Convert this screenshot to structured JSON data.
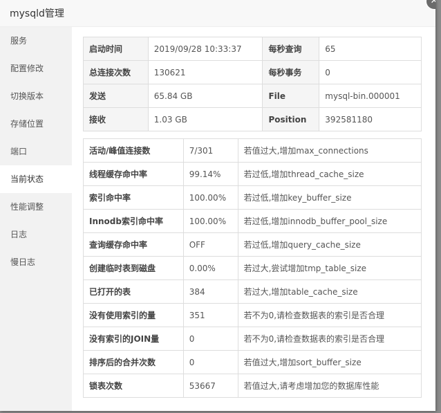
{
  "dialog": {
    "title": "mysqld管理",
    "close_icon": "close-icon"
  },
  "sidebar": {
    "active_index": 5,
    "items": [
      {
        "label": "服务"
      },
      {
        "label": "配置修改"
      },
      {
        "label": "切换版本"
      },
      {
        "label": "存储位置"
      },
      {
        "label": "端口"
      },
      {
        "label": "当前状态"
      },
      {
        "label": "性能调整"
      },
      {
        "label": "日志"
      },
      {
        "label": "慢日志"
      }
    ]
  },
  "info": {
    "rows": [
      [
        {
          "key": "启动时间",
          "value": "2019/09/28 10:33:37"
        },
        {
          "key": "每秒查询",
          "value": "65"
        }
      ],
      [
        {
          "key": "总连接次数",
          "value": "130621"
        },
        {
          "key": "每秒事务",
          "value": "0"
        }
      ],
      [
        {
          "key": "发送",
          "value": "65.84 GB"
        },
        {
          "key": "File",
          "value": "mysql-bin.000001"
        }
      ],
      [
        {
          "key": "接收",
          "value": "1.03 GB"
        },
        {
          "key": "Position",
          "value": "392581180"
        }
      ]
    ]
  },
  "status": {
    "rows": [
      {
        "name": "活动/峰值连接数",
        "value": "7/301",
        "advice": "若值过大,增加max_connections"
      },
      {
        "name": "线程缓存命中率",
        "value": "99.14%",
        "advice": "若过低,增加thread_cache_size"
      },
      {
        "name": "索引命中率",
        "value": "100.00%",
        "advice": "若过低,增加key_buffer_size"
      },
      {
        "name": "Innodb索引命中率",
        "value": "100.00%",
        "advice": "若过低,增加innodb_buffer_pool_size"
      },
      {
        "name": "查询缓存命中率",
        "value": "OFF",
        "advice": "若过低,增加query_cache_size"
      },
      {
        "name": "创建临时表到磁盘",
        "value": "0.00%",
        "advice": "若过大,尝试增加tmp_table_size"
      },
      {
        "name": "已打开的表",
        "value": "384",
        "advice": "若过大,增加table_cache_size"
      },
      {
        "name": "没有使用索引的量",
        "value": "351",
        "advice": "若不为0,请检查数据表的索引是否合理"
      },
      {
        "name": "没有索引的JOIN量",
        "value": "0",
        "advice": "若不为0,请检查数据表的索引是否合理"
      },
      {
        "name": "排序后的合并次数",
        "value": "0",
        "advice": "若值过大,增加sort_buffer_size"
      },
      {
        "name": "锁表次数",
        "value": "53667",
        "advice": "若值过大,请考虑增加您的数据库性能"
      }
    ]
  }
}
